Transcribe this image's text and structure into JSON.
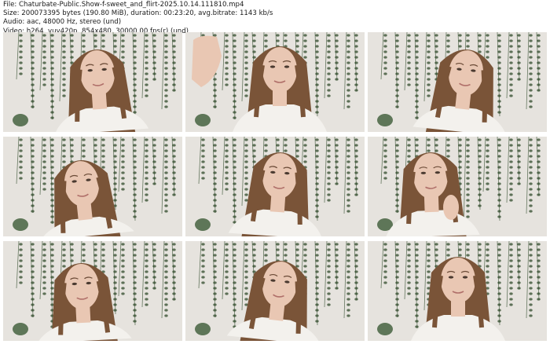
{
  "header": {
    "file_line": "File: Chaturbate-Public.Show-f-sweet_and_flirt-2025.10.14.111810.mp4",
    "size_line": "Size: 200073395 bytes (190.80 MiB), duration: 00:23:20, avg.bitrate: 1143 kb/s",
    "audio_line": "Audio: aac, 48000 Hz, stereo (und)",
    "video_line": "Video: h264, yuv420p, 854x480, 30000.00 fps(r) (und)"
  },
  "frames": [
    {
      "pose": "center-left"
    },
    {
      "pose": "center-arm-raised"
    },
    {
      "pose": "center-eyes-closed"
    },
    {
      "pose": "left-looking-down"
    },
    {
      "pose": "center-close"
    },
    {
      "pose": "left-hand-near-face"
    },
    {
      "pose": "left-smirk"
    },
    {
      "pose": "center-tilted"
    },
    {
      "pose": "center-smiling"
    }
  ],
  "colors": {
    "wall": "#e6e3de",
    "vines": "#2f4a2a",
    "hair": "#7a5438",
    "skin": "#e9c7b3",
    "shirt": "#f3f1ed"
  }
}
